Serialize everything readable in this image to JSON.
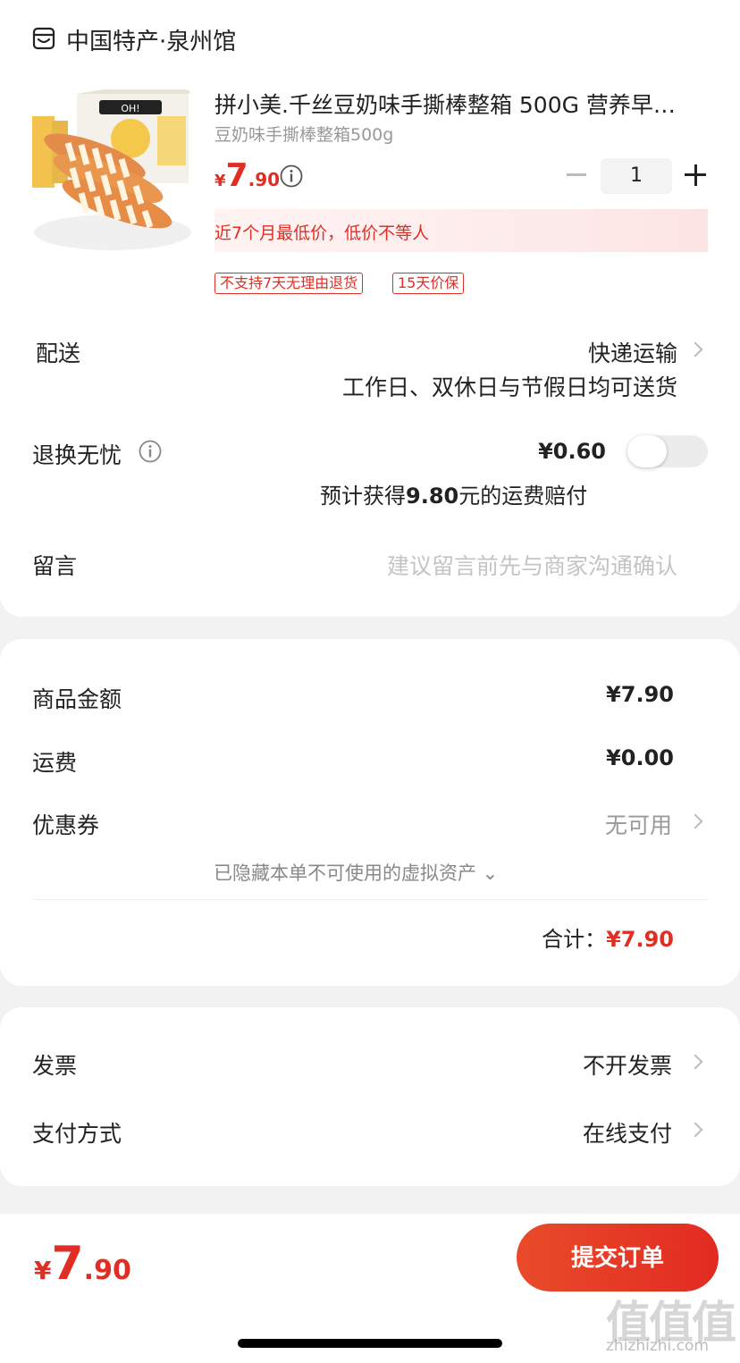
{
  "shop": {
    "name": "中国特产·泉州馆",
    "icon": "store-icon"
  },
  "product": {
    "title": "拼小美.千丝豆奶味手撕棒整箱 500G 营养早…",
    "spec": "豆奶味手撕棒整箱500g",
    "price_yen": "¥",
    "price_int": "7",
    "price_dec": ".90",
    "quantity": "1",
    "lowest_note": "近7个月最低价，低价不等人",
    "tags": [
      "不支持7天无理由退货",
      "15天价保"
    ]
  },
  "delivery": {
    "label": "配送",
    "method": "快递运输",
    "note": "工作日、双休日与节假日均可送货"
  },
  "return_insurance": {
    "label": "退换无忧",
    "price": "¥0.60",
    "note_prefix": "预计获得",
    "note_amount": "9.80",
    "note_suffix": "元的运费赔付",
    "enabled": false
  },
  "message": {
    "label": "留言",
    "placeholder": "建议留言前先与商家沟通确认"
  },
  "summary": {
    "goods_label": "商品金额",
    "goods_value": "¥7.90",
    "shipping_label": "运费",
    "shipping_value": "¥0.00",
    "coupon_label": "优惠券",
    "coupon_value": "无可用",
    "hidden_assets": "已隐藏本单不可使用的虚拟资产",
    "total_label": "合计：",
    "total_value": "¥7.90"
  },
  "invoice": {
    "label": "发票",
    "value": "不开发票"
  },
  "payment": {
    "label": "支付方式",
    "value": "在线支付"
  },
  "bottom": {
    "price_yen": "¥",
    "price_int": "7",
    "price_dec": ".90",
    "submit_label": "提交订单"
  },
  "watermark": {
    "logo": "值值值",
    "url": "zhizhizhi.com"
  },
  "colors": {
    "accent": "#e02e24",
    "muted": "#999999"
  }
}
